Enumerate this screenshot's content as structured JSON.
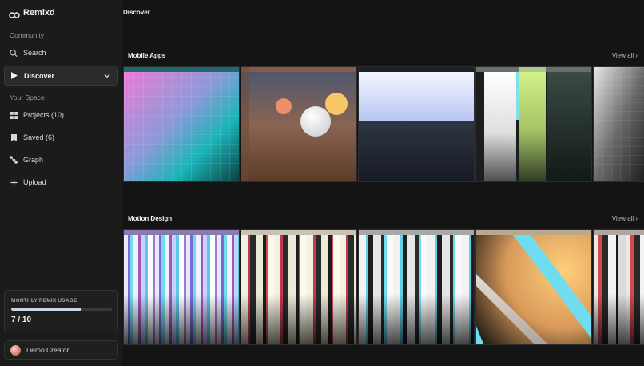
{
  "brand": {
    "name": "Remixd",
    "logo_icon": "infinity-icon"
  },
  "sidebar": {
    "community_label": "Community",
    "search_label": "Search",
    "discover_label": "Discover",
    "your_space_label": "Your Space",
    "projects_label": "Projects (10)",
    "saved_label": "Saved (6)",
    "graph_label": "Graph",
    "upload_label": "Upload"
  },
  "usage": {
    "label": "MONTHLY REMIX USAGE",
    "used": 7,
    "total": 10,
    "count_text": "7 / 10",
    "fill_fraction": 0.7
  },
  "user": {
    "name": "Demo Creator"
  },
  "main": {
    "title": "Discover",
    "rows": [
      {
        "title": "Mobile Apps",
        "view_all": "View all ›"
      },
      {
        "title": "Motion Design",
        "view_all": "View all ›"
      }
    ]
  },
  "colors": {
    "accent_bar": "#c8d6e6",
    "background": "#141414",
    "sidebar": "#1b1b1b"
  }
}
